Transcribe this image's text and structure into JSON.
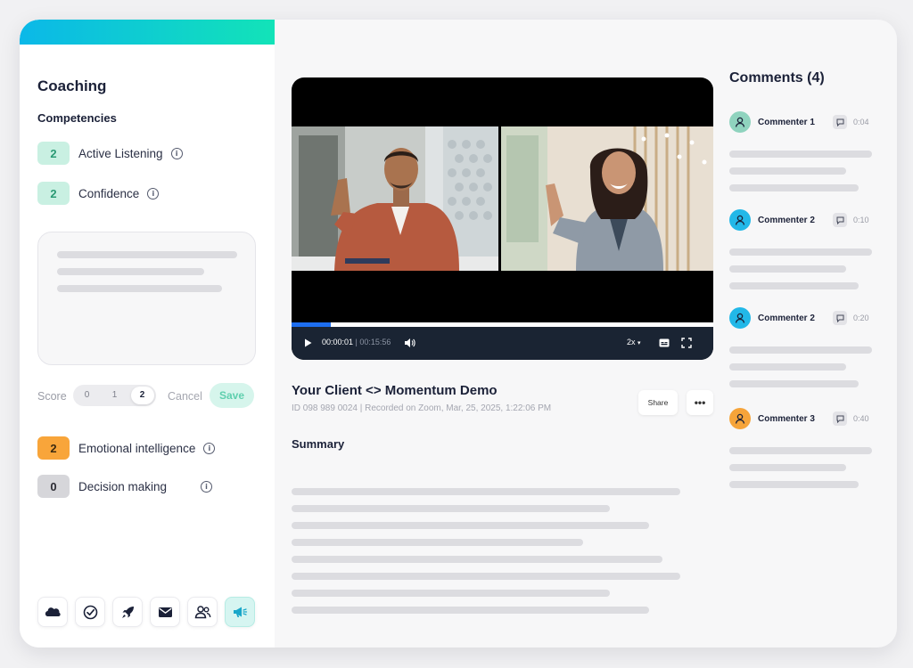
{
  "sidebar": {
    "title": "Coaching",
    "competencies_heading": "Competencies",
    "competencies_top": [
      {
        "score": "2",
        "label": "Active Listening",
        "color": "green"
      },
      {
        "score": "2",
        "label": "Confidence",
        "color": "green"
      }
    ],
    "score_label": "Score",
    "score_options": [
      "0",
      "1",
      "2"
    ],
    "score_selected": "2",
    "cancel_label": "Cancel",
    "save_label": "Save",
    "competencies_bottom": [
      {
        "score": "2",
        "label": "Emotional intelligence",
        "color": "orange"
      },
      {
        "score": "0",
        "label": "Decision making",
        "color": "grey"
      }
    ],
    "toolbar_icons": [
      "salesforce-cloud-icon",
      "check-circle-icon",
      "rocket-icon",
      "mail-icon",
      "users-icon",
      "megaphone-icon"
    ],
    "toolbar_active": "megaphone-icon",
    "accent_gradient": [
      "#0bb8e8",
      "#12e3b8"
    ]
  },
  "video": {
    "current_time": "00:00:01",
    "duration": "00:15:56",
    "speed": "2x",
    "progress": 0.093,
    "progress_color": "#1d6ef0"
  },
  "recording": {
    "title": "Your Client <> Momentum Demo",
    "meta": "ID 098 989 0024 | Recorded on Zoom, Mar, 25, 2025, 1:22:06 PM",
    "share_label": "Share",
    "more_label": "•••",
    "summary_heading": "Summary"
  },
  "comments": {
    "heading": "Comments (4)",
    "items": [
      {
        "name": "Commenter 1",
        "time": "0:04",
        "avatar_color": "#8fd3be"
      },
      {
        "name": "Commenter 2",
        "time": "0:10",
        "avatar_color": "#22b8e8"
      },
      {
        "name": "Commenter 2",
        "time": "0:20",
        "avatar_color": "#22b8e8"
      },
      {
        "name": "Commenter 3",
        "time": "0:40",
        "avatar_color": "#f6a43a"
      }
    ]
  }
}
